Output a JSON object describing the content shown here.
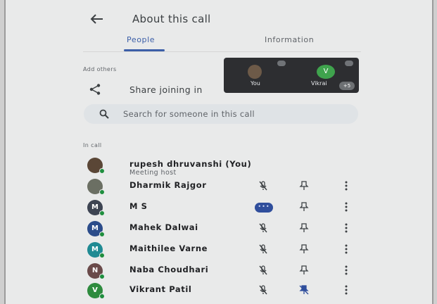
{
  "header": {
    "title": "About this call",
    "back_icon": "arrow-left-icon"
  },
  "tabs": [
    {
      "label": "People",
      "active": true
    },
    {
      "label": "Information",
      "active": false
    }
  ],
  "add_others": {
    "section_label": "Add others",
    "share_label": "Share joining in",
    "share_icon": "share-icon"
  },
  "video_tiles": [
    {
      "name": "You"
    },
    {
      "name": "Vikrai",
      "initial": "V"
    }
  ],
  "more_count": "+5",
  "search": {
    "placeholder": "Search for someone in this call",
    "icon": "search-icon"
  },
  "in_call": {
    "section_label": "In call",
    "participants": [
      {
        "name": "rupesh dhruvanshi (You)",
        "role": "Meeting host",
        "initial": "",
        "avatar_color": "#5a4636",
        "photo": true
      },
      {
        "name": "Dharmik Rajgor",
        "initial": "",
        "avatar_color": "#6b6f63",
        "photo": true,
        "mic": "muted"
      },
      {
        "name": "M S",
        "initial": "M",
        "avatar_color": "#3d4452",
        "mic": "speaking"
      },
      {
        "name": "Mahek Dalwai",
        "initial": "M",
        "avatar_color": "#2b4c8a",
        "mic": "muted"
      },
      {
        "name": "Maithilee Varne",
        "initial": "M",
        "avatar_color": "#1f8a93",
        "mic": "muted"
      },
      {
        "name": "Naba Choudhari",
        "initial": "N",
        "avatar_color": "#6a4a4a",
        "mic": "muted"
      },
      {
        "name": "Vikrant Patil",
        "initial": "V",
        "avatar_color": "#2e8b3e",
        "mic": "muted",
        "pinned": true
      }
    ]
  },
  "colors": {
    "accent": "#3c5fa8",
    "online": "#1e8e3e",
    "talking": "#2f4e9c"
  }
}
